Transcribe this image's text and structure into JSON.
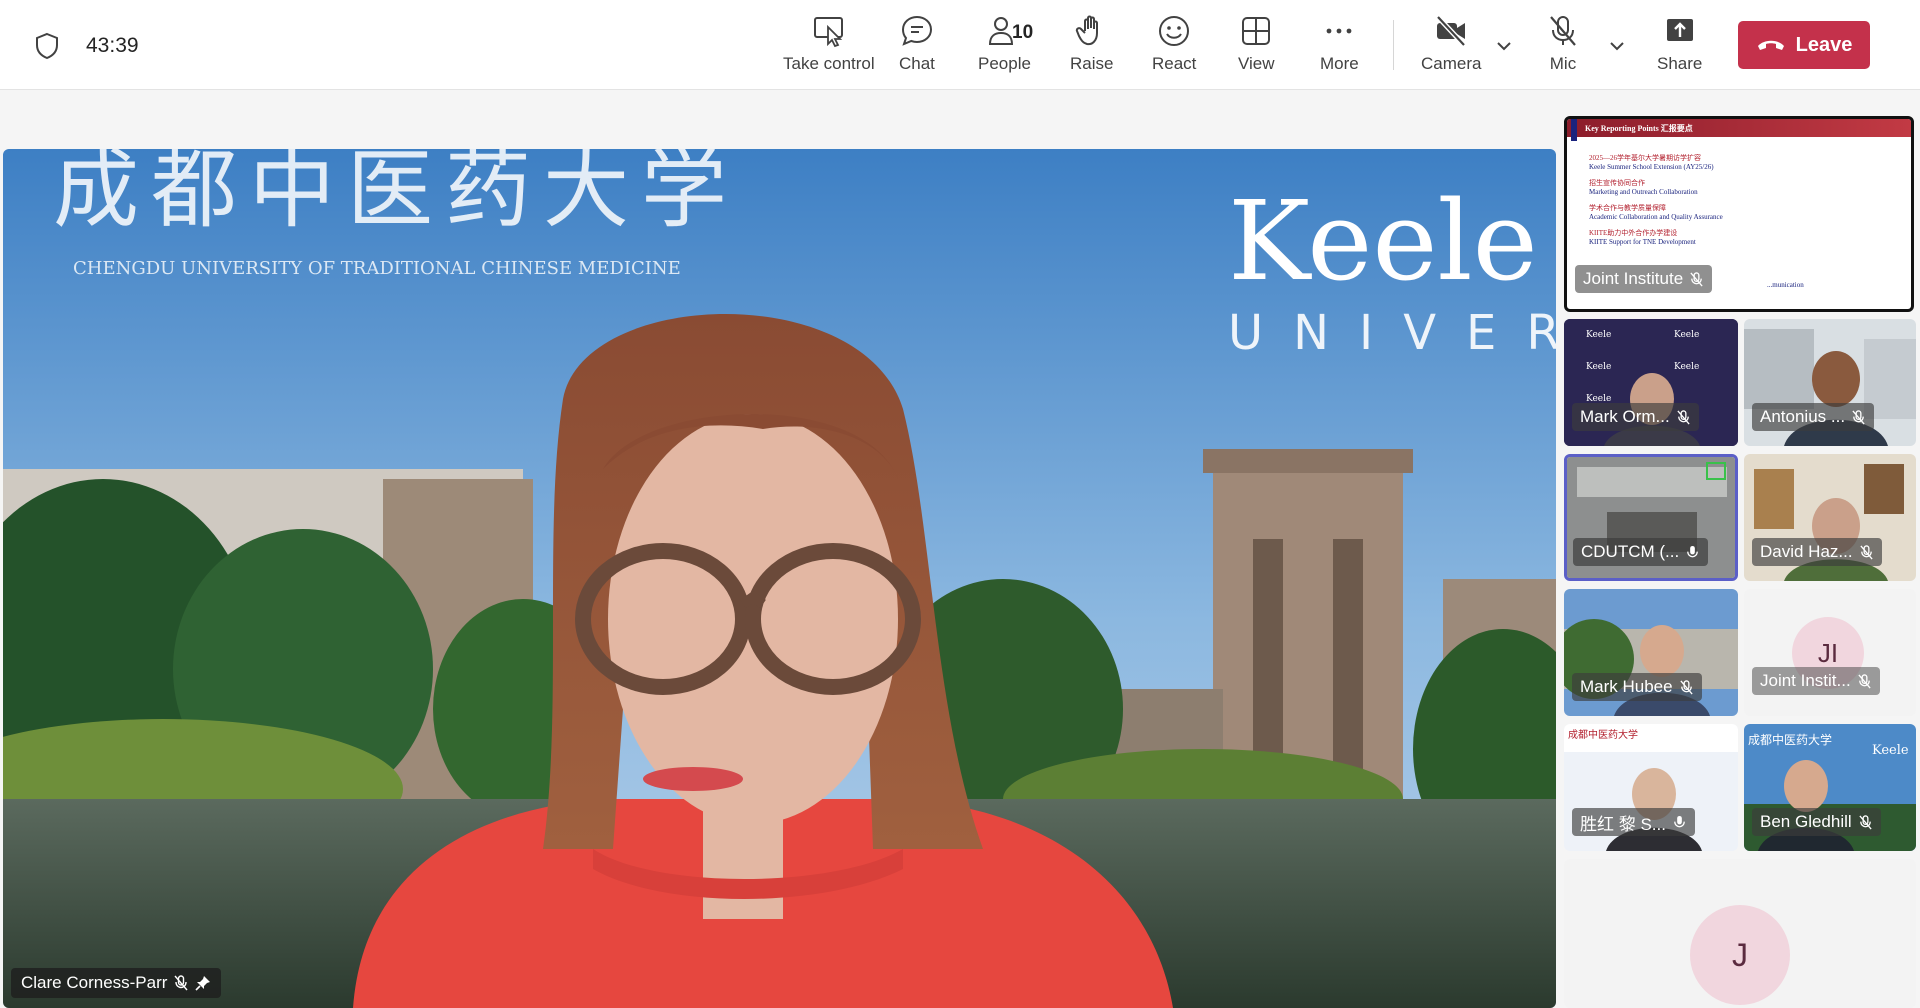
{
  "header": {
    "timer": "43:39",
    "buttons": {
      "take_control": "Take control",
      "chat": "Chat",
      "people": "People",
      "people_count": "10",
      "raise": "Raise",
      "react": "React",
      "view": "View",
      "more": "More",
      "camera": "Camera",
      "mic": "Mic",
      "share": "Share",
      "leave": "Leave"
    }
  },
  "main_video": {
    "name": "Clare Corness-Parr",
    "background_text": {
      "chinese": "成都中医药大学",
      "english": "CHENGDU UNIVERSITY OF TRADITIONAL CHINESE MEDICINE",
      "keele": "Keele",
      "univer": "UNIVERS"
    }
  },
  "shared_screen": {
    "name": "Joint Institute",
    "title": "Key Reporting Points 汇报要点",
    "bullets": [
      {
        "cn": "2025—26学年基尔大学暑期访学扩容",
        "en": "Keele Summer School Extension (AY25/26)"
      },
      {
        "cn": "招生宣传协同合作",
        "en": "Marketing and Outreach Collaboration"
      },
      {
        "cn": "学术合作与教学质量保障",
        "en": "Academic Collaboration and Quality Assurance"
      },
      {
        "cn": "KIITE助力中外合作办学建设",
        "en": "KIITE Support for TNE Development"
      }
    ],
    "tail": "...munication"
  },
  "participants": [
    {
      "name": "Mark Orm..."
    },
    {
      "name": "Antonius ..."
    },
    {
      "name": "CDUTCM (..."
    },
    {
      "name": "David Haz..."
    },
    {
      "name": "Mark Hubee"
    },
    {
      "name": "Joint Instit...",
      "initials": "JI"
    },
    {
      "name": "胜红 黎  S..."
    },
    {
      "name": "Ben Gledhill"
    },
    {
      "initials": "J"
    }
  ],
  "colors": {
    "leave": "#c4314b",
    "avatar_bg": "#f1d6de",
    "active_border": "#5b5fc7"
  }
}
